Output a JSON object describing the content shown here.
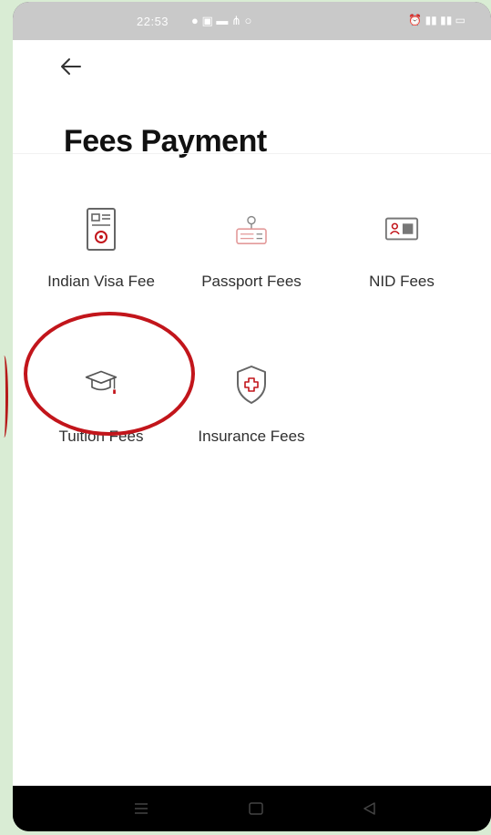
{
  "status_bar": {
    "time": "22:53",
    "left_icons": "● ▣ ▬ ⋔ ○",
    "right_icons": "⏰ ▮▮ ▮▮ ▭"
  },
  "header": {
    "title": "Fees Payment"
  },
  "tiles": [
    {
      "label": "Indian Visa Fee",
      "icon": "visa-document-icon"
    },
    {
      "label": "Passport Fees",
      "icon": "passport-icon"
    },
    {
      "label": "NID Fees",
      "icon": "id-card-icon"
    },
    {
      "label": "Tuition Fees",
      "icon": "graduation-cap-icon"
    },
    {
      "label": "Insurance Fees",
      "icon": "shield-plus-icon"
    }
  ],
  "colors": {
    "accent": "#c2151b",
    "icon_gray": "#7a7a7a"
  }
}
